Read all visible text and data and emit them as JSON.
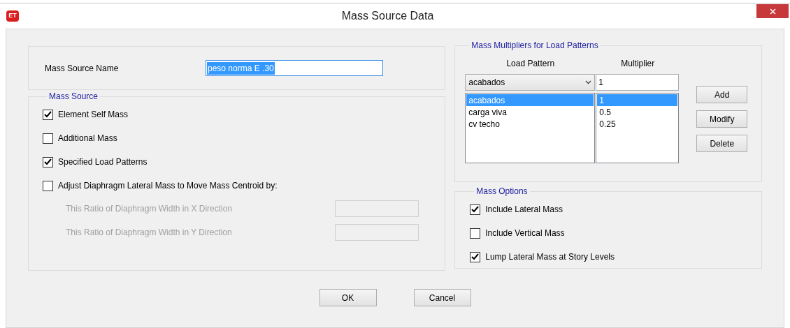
{
  "window": {
    "title": "Mass Source Data",
    "app_icon": "ET"
  },
  "name_field": {
    "label": "Mass Source Name",
    "value": "peso norma E .30"
  },
  "mass_source": {
    "title": "Mass Source",
    "options": [
      {
        "label": "Element Self Mass",
        "checked": true
      },
      {
        "label": "Additional Mass",
        "checked": false
      },
      {
        "label": "Specified Load Patterns",
        "checked": true
      },
      {
        "label": "Adjust Diaphragm Lateral Mass to Move Mass Centroid by:",
        "checked": false
      }
    ],
    "ratios": [
      {
        "label": "This Ratio of Diaphragm Width in X Direction",
        "disabled": true
      },
      {
        "label": "This Ratio of Diaphragm Width in Y Direction",
        "disabled": true
      }
    ]
  },
  "multipliers": {
    "title": "Mass Multipliers for Load Patterns",
    "columns": [
      "Load Pattern",
      "Multiplier"
    ],
    "pattern_value": "acabados",
    "multiplier_value": "1",
    "rows": [
      {
        "pattern": "acabados",
        "multiplier": "1",
        "selected": true
      },
      {
        "pattern": "carga viva",
        "multiplier": "0.5",
        "selected": false
      },
      {
        "pattern": "cv techo",
        "multiplier": "0.25",
        "selected": false
      }
    ],
    "buttons": [
      "Add",
      "Modify",
      "Delete"
    ]
  },
  "mass_options": {
    "title": "Mass Options",
    "options": [
      {
        "label": "Include Lateral Mass",
        "checked": true
      },
      {
        "label": "Include Vertical Mass",
        "checked": false
      },
      {
        "label": "Lump Lateral Mass at Story Levels",
        "checked": true
      }
    ]
  },
  "buttons": [
    "OK",
    "Cancel"
  ]
}
